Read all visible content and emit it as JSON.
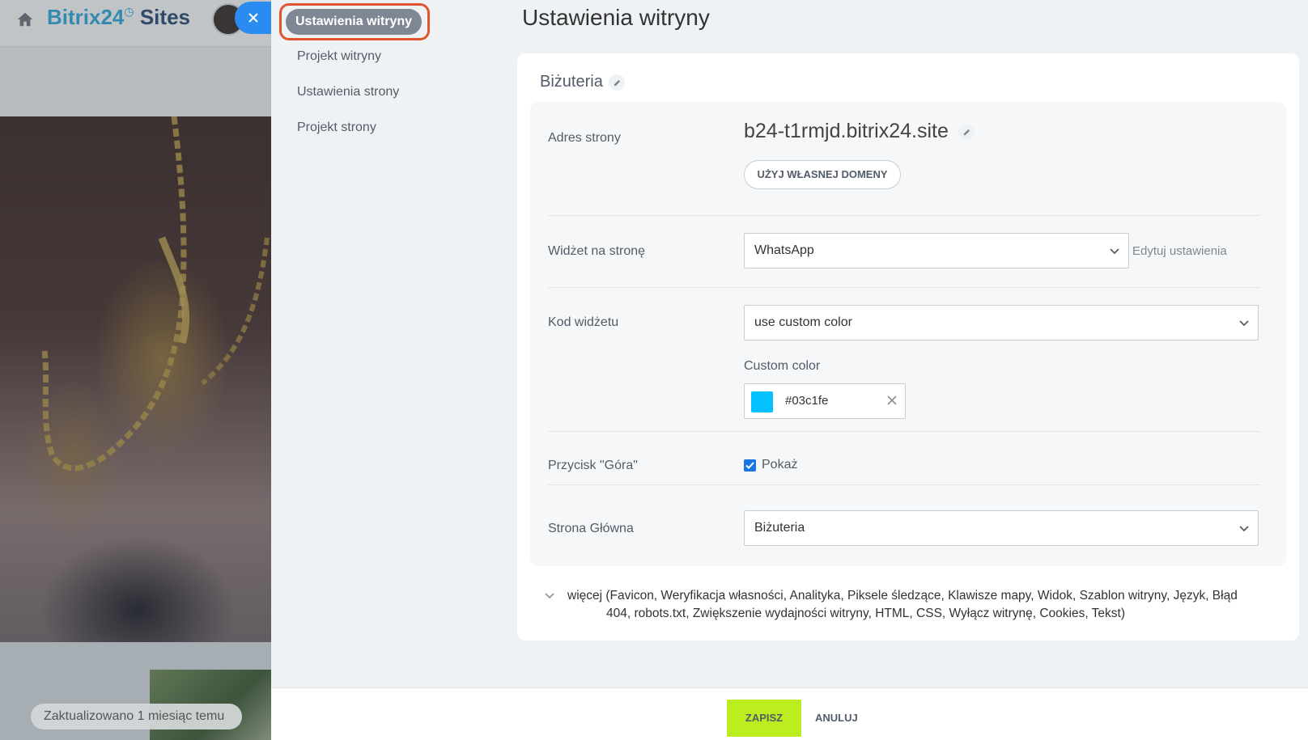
{
  "background": {
    "logo_brand": "Bitrix24",
    "logo_product": "Sites",
    "updated": "Zaktualizowano 1 miesiąc temu"
  },
  "nav": {
    "items": [
      {
        "label": "Ustawienia witryny",
        "active": true
      },
      {
        "label": "Projekt witryny"
      },
      {
        "label": "Ustawienia strony"
      },
      {
        "label": "Projekt strony"
      }
    ]
  },
  "page_title": "Ustawienia witryny",
  "site_name": "Biżuteria",
  "address": {
    "label": "Adres strony",
    "domain": "b24-t1rmjd.bitrix24.site",
    "own_domain_button": "UŻYJ WŁASNEJ DOMENY"
  },
  "widget": {
    "label": "Widżet na stronę",
    "value": "WhatsApp",
    "edit_link": "Edytuj ustawienia"
  },
  "widget_code": {
    "label": "Kod widżetu",
    "value": "use custom color",
    "custom_label": "Custom color",
    "color_hex": "#03c1fe",
    "color_text": "#03c1fe"
  },
  "top_button": {
    "label": "Przycisk \"Góra\"",
    "checkbox_label": "Pokaż",
    "checked": true
  },
  "home_page": {
    "label": "Strona Główna",
    "value": "Biżuteria"
  },
  "more": {
    "text": "więcej (Favicon,  Weryfikacja własności,  Analityka,  Piksele śledzące,  Klawisze mapy,  Widok,  Szablon witryny,  Język,  Błąd 404,  robots.txt,  Zwiększenie wydajności witryny,  HTML,  CSS,  Wyłącz witrynę,  Cookies,  Tekst)"
  },
  "footer": {
    "save": "ZAPISZ",
    "cancel": "ANULUJ"
  },
  "colors": {
    "accent": "#2a8cf0",
    "save_button": "#bbed21",
    "highlight_ring": "#e0542e"
  }
}
